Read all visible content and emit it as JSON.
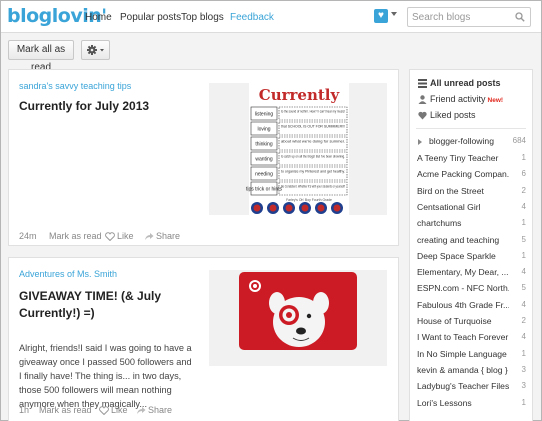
{
  "header": {
    "logo": "bloglovin'",
    "nav": [
      "Home",
      "Popular posts",
      "Top blogs",
      "Feedback"
    ],
    "search_placeholder": "Search blogs",
    "accent": "#3aa4d8"
  },
  "toolbar": {
    "mark_all_label": "Mark all as read",
    "settings_icon": "gear-icon"
  },
  "posts": [
    {
      "source": "sandra's savvy teaching tips",
      "title": "Currently for July 2013",
      "time": "24m",
      "mark_read": "Mark as read",
      "like": "Like",
      "share": "Share",
      "thumb": {
        "heading": "Currently",
        "rows": [
          {
            "label": "listening",
            "text": "to the sound of nothin'. How?! I can't hear my music!"
          },
          {
            "label": "loving",
            "text": "that SCHOOL IS OUT FOR SUMMMER!!!"
          },
          {
            "label": "thinking",
            "text": "about what we're doing for summer."
          },
          {
            "label": "wanting",
            "text": "to catch up on all the blogs! But I've been drowning."
          },
          {
            "label": "needing",
            "text": "to organize my Pinterest and get healthy."
          },
          {
            "label": "tips trick or hints",
            "text": "Be Consistent. Whether it's with your students or yourself!"
          }
        ],
        "footer": "Farley's Oh' Boy Fourth Grade"
      }
    },
    {
      "source": "Adventures of Ms. Smith",
      "title": "GIVEAWAY TIME! (& July Currently!) =)",
      "excerpt": "Alright, friends!I said I was going to have a giveaway once I passed 500 followers and I finally have! The thing is... in two days, those 500 followers will mean nothing anymore when they magically...",
      "time": "1h",
      "mark_read": "Mark as read",
      "like": "Like",
      "share": "Share"
    }
  ],
  "sidebar": {
    "all_unread": "All unread posts",
    "friend_activity": "Friend activity",
    "new_badge": "New!",
    "liked_posts": "Liked posts",
    "folder": {
      "name": "blogger-following",
      "count": "684"
    },
    "blogs": [
      {
        "name": "A Teeny Tiny Teacher",
        "count": "1"
      },
      {
        "name": "Acme Packing Compan...",
        "count": "6"
      },
      {
        "name": "Bird on the Street",
        "count": "2"
      },
      {
        "name": "Centsational Girl",
        "count": "4"
      },
      {
        "name": "chartchums",
        "count": "1"
      },
      {
        "name": "creating and teaching",
        "count": "5"
      },
      {
        "name": "Deep Space Sparkle",
        "count": "1"
      },
      {
        "name": "Elementary, My Dear, ...",
        "count": "4"
      },
      {
        "name": "ESPN.com - NFC North...",
        "count": "5"
      },
      {
        "name": "Fabulous 4th Grade Fr...",
        "count": "4"
      },
      {
        "name": "House of Turquoise",
        "count": "2"
      },
      {
        "name": "I Want to Teach Forever",
        "count": "4"
      },
      {
        "name": "In No Simple Language",
        "count": "1"
      },
      {
        "name": "kevin & amanda { blog }",
        "count": "3"
      },
      {
        "name": "Ladybug's Teacher Files",
        "count": "3"
      },
      {
        "name": "Lori's Lessons",
        "count": "1"
      }
    ]
  }
}
